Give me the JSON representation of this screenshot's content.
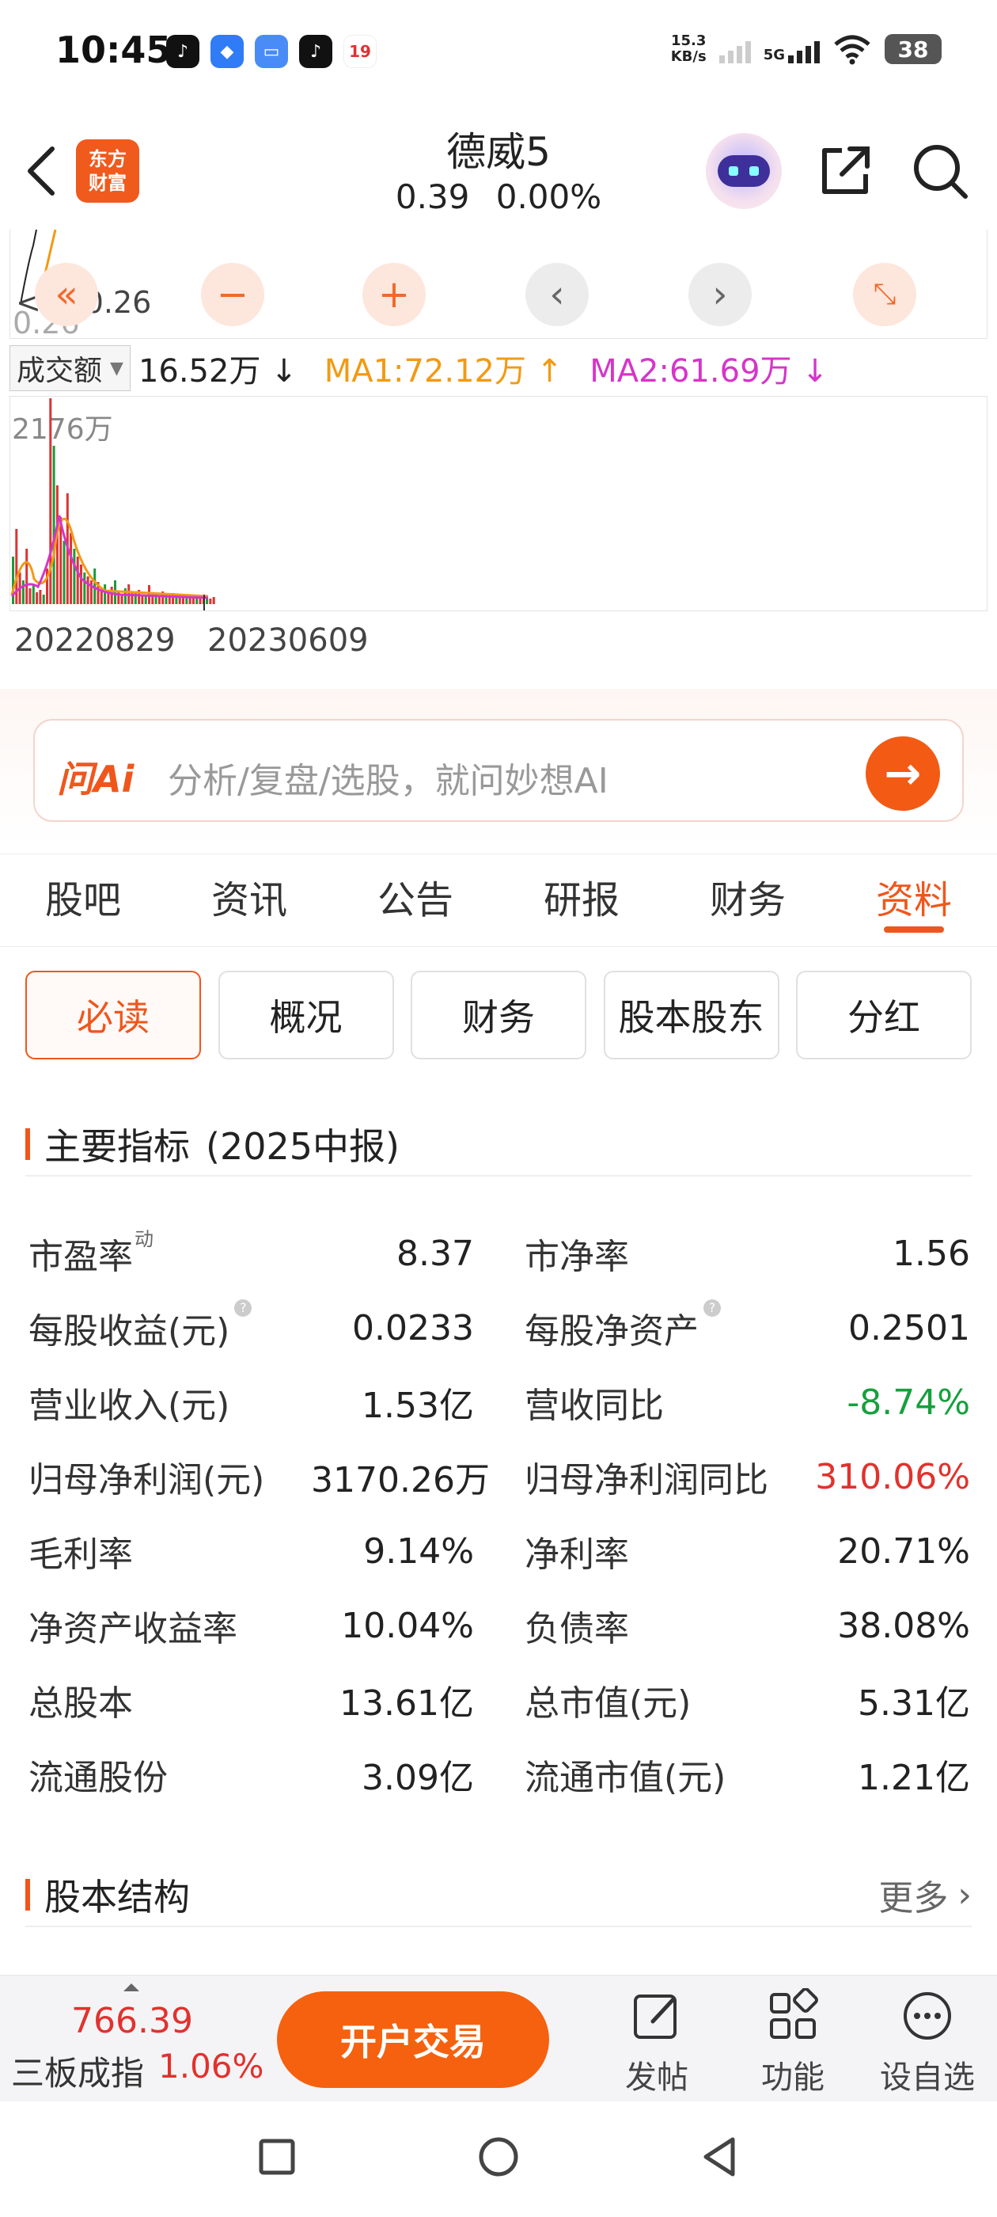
{
  "status_bar": {
    "time": "10:45",
    "net_speed_value": "15.3",
    "net_speed_unit": "KB/s",
    "signal_label": "5G",
    "battery": "38",
    "calendar_day": "19"
  },
  "header": {
    "logo_line1": "东方",
    "logo_line2": "财富",
    "stock_name": "德威5",
    "price": "0.39",
    "change_pct": "0.00%"
  },
  "kline": {
    "price_faded": "0.26",
    "price_marker": "<----0.26"
  },
  "volume": {
    "selector_label": "成交额",
    "value": "16.52万 ↓",
    "ma1": "MA1:72.12万 ↑",
    "ma2": "MA2:61.69万 ↓",
    "max_label": "2176万",
    "date_start": "20220829",
    "date_end": "20230609"
  },
  "ai_search": {
    "logo": "问Ai",
    "placeholder": "分析/复盘/选股，就问妙想AI"
  },
  "tabs": [
    {
      "label": "股吧"
    },
    {
      "label": "资讯"
    },
    {
      "label": "公告"
    },
    {
      "label": "研报"
    },
    {
      "label": "财务"
    },
    {
      "label": "资料"
    }
  ],
  "subtabs": [
    {
      "label": "必读"
    },
    {
      "label": "概况"
    },
    {
      "label": "财务"
    },
    {
      "label": "股本股东"
    },
    {
      "label": "分红"
    }
  ],
  "key_metrics": {
    "title": "主要指标",
    "period": "(2025中报)",
    "rows": [
      {
        "l_label": "市盈率",
        "l_sup": "动",
        "l_value": "8.37",
        "r_label": "市净率",
        "r_value": "1.56"
      },
      {
        "l_label": "每股收益(元)",
        "l_value": "0.0233",
        "r_label": "每股净资产",
        "r_value": "0.2501"
      },
      {
        "l_label": "营业收入(元)",
        "l_value": "1.53亿",
        "r_label": "营收同比",
        "r_value": "-8.74%"
      },
      {
        "l_label": "归母净利润(元)",
        "l_value": "3170.26万",
        "r_label": "归母净利润同比",
        "r_value": "310.06%"
      },
      {
        "l_label": "毛利率",
        "l_value": "9.14%",
        "r_label": "净利率",
        "r_value": "20.71%"
      },
      {
        "l_label": "净资产收益率",
        "l_value": "10.04%",
        "r_label": "负债率",
        "r_value": "38.08%"
      },
      {
        "l_label": "总股本",
        "l_value": "13.61亿",
        "r_label": "总市值(元)",
        "r_value": "5.31亿"
      },
      {
        "l_label": "流通股份",
        "l_value": "3.09亿",
        "r_label": "流通市值(元)",
        "r_value": "1.21亿"
      }
    ]
  },
  "capital_structure": {
    "title": "股本结构",
    "more": "更多"
  },
  "bottom_bar": {
    "index_value": "766.39",
    "index_name": "三板成指",
    "index_change": "1.06%",
    "trade_button": "开户交易",
    "nav": [
      {
        "label": "发帖",
        "icon": "edit-icon"
      },
      {
        "label": "功能",
        "icon": "grid-icon"
      },
      {
        "label": "设自选",
        "icon": "more-dots-icon"
      }
    ]
  },
  "colors": {
    "accent": "#f0561c",
    "up": "#e1322e",
    "down": "#16a03c",
    "ma1": "#f29a13",
    "ma2": "#d535c9"
  }
}
